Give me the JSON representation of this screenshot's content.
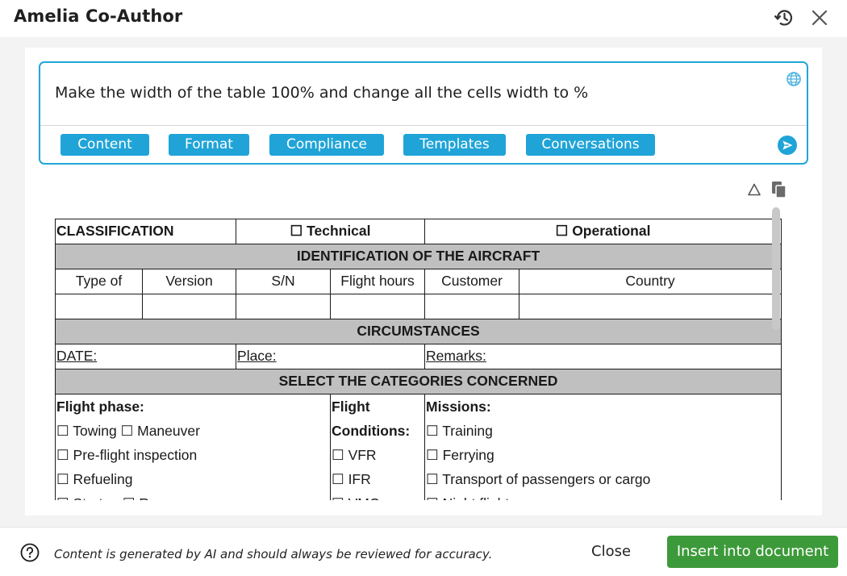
{
  "window": {
    "title": "Amelia Co-Author"
  },
  "prompt": {
    "text": "Make the width of the table 100% and change all the cells width to %",
    "chips": [
      "Content",
      "Format",
      "Compliance",
      "Templates",
      "Conversations"
    ]
  },
  "colors": {
    "accent": "#20a4d8",
    "primary_button": "#3d9a3a",
    "table_header_shade": "#c0c0c0"
  },
  "icons": {
    "history": "history-icon",
    "close": "close-icon",
    "globe": "globe-icon",
    "send": "send-icon",
    "triangle": "triangle-icon",
    "copy": "copy-icon",
    "help": "help-icon"
  },
  "doc": {
    "classification": "CLASSIFICATION",
    "technical": "☐ Technical",
    "operational": "☐ Operational",
    "identification_header": "IDENTIFICATION OF THE AIRCRAFT",
    "columns": [
      "Type of",
      "Version",
      "S/N",
      "Flight hours",
      "Customer",
      "Country"
    ],
    "circumstances_header": "CIRCUMSTANCES",
    "date_label": "DATE:",
    "place_label": "Place:",
    "remarks_label": "Remarks:",
    "categories_header": "SELECT THE CATEGORIES CONCERNED",
    "flight_phase": {
      "title": "Flight phase:",
      "items": [
        "☐ Towing ☐ Maneuver",
        "☐ Pre-flight inspection",
        "☐ Refueling",
        "☐ Startup ☐ Run-up"
      ]
    },
    "flight_conditions": {
      "title_line1": "Flight",
      "title_line2": "Conditions:",
      "items": [
        "☐ VFR",
        "☐ IFR",
        "☐ VMC"
      ]
    },
    "missions": {
      "title": "Missions:",
      "items": [
        "☐ Training",
        "☐ Ferrying",
        "☐ Transport of passengers or cargo",
        "☐ Night flight"
      ]
    }
  },
  "footer": {
    "disclaimer": "Content is generated by AI and should always be reviewed for accuracy.",
    "close_label": "Close",
    "insert_label": "Insert into document"
  }
}
